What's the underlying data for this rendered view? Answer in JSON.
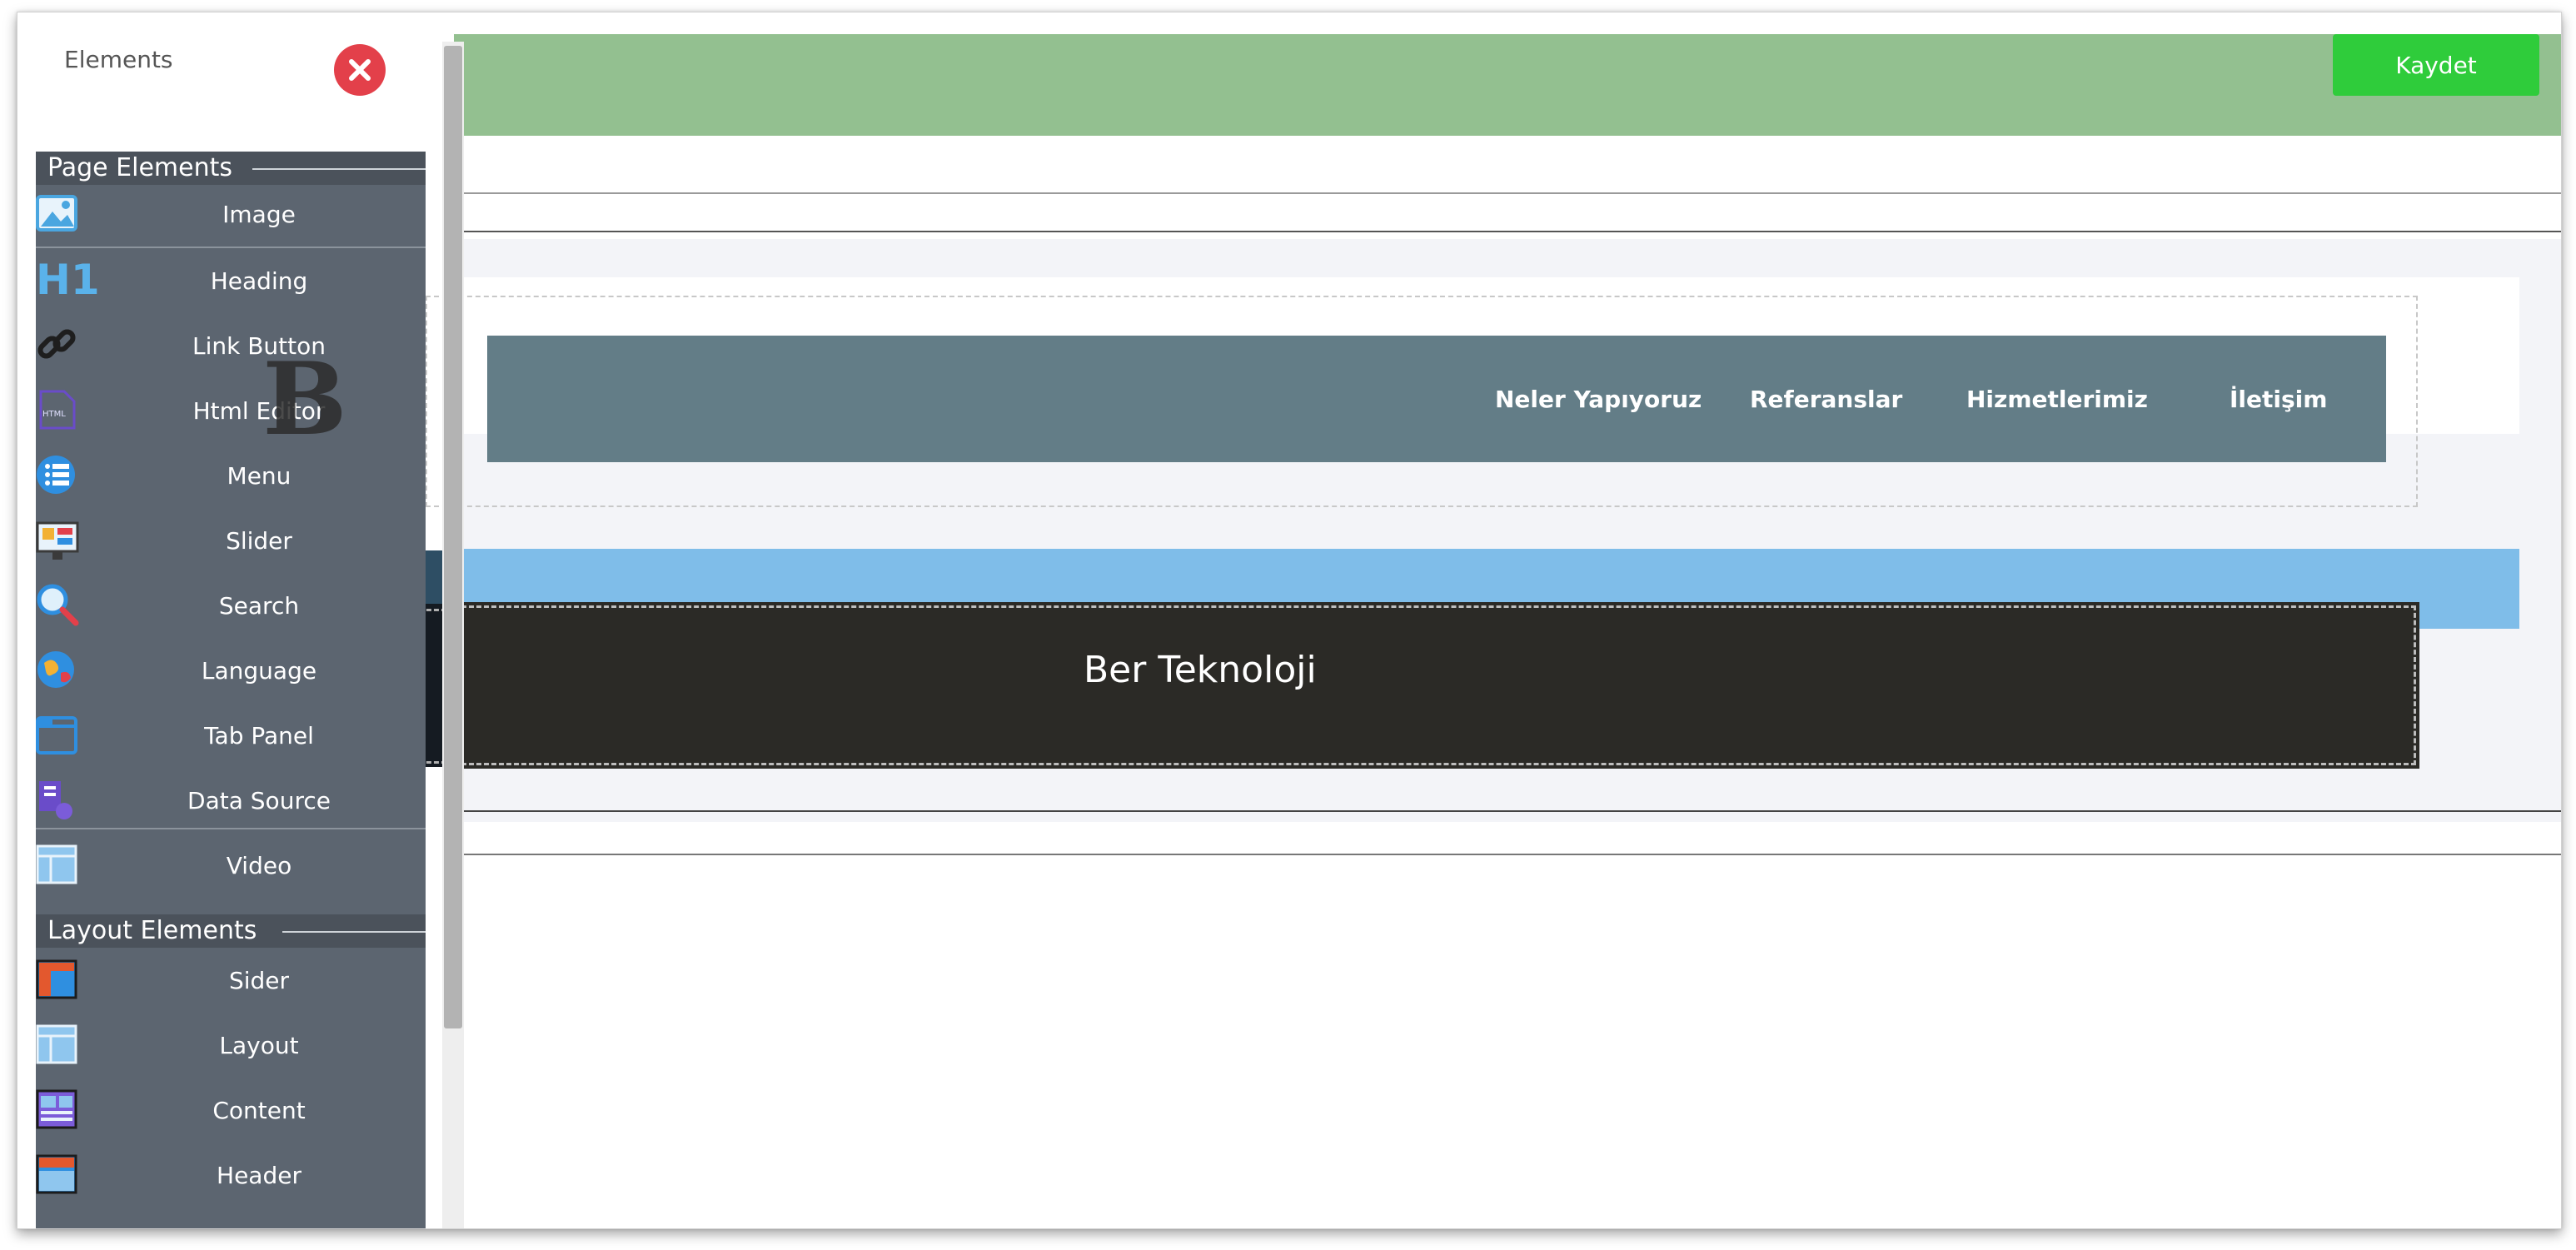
{
  "panel": {
    "title": "Elements",
    "close_icon": "close-icon",
    "page_elements_label": "Page Elements",
    "layout_elements_label": "Layout Elements",
    "page_items": [
      {
        "label": "Image",
        "icon": "image-icon"
      },
      {
        "label": "Heading",
        "icon": "heading-icon",
        "glyph": "H1"
      },
      {
        "label": "Link Button",
        "icon": "link-icon"
      },
      {
        "label": "Html Editor",
        "icon": "html-icon",
        "glyph": "HTML"
      },
      {
        "label": "Menu",
        "icon": "menu-icon"
      },
      {
        "label": "Slider",
        "icon": "slider-icon"
      },
      {
        "label": "Search",
        "icon": "search-icon"
      },
      {
        "label": "Language",
        "icon": "language-icon"
      },
      {
        "label": "Tab Panel",
        "icon": "tab-panel-icon"
      },
      {
        "label": "Data Source",
        "icon": "data-source-icon"
      },
      {
        "label": "Video",
        "icon": "video-icon"
      }
    ],
    "layout_items": [
      {
        "label": "Sider",
        "icon": "sider-icon"
      },
      {
        "label": "Layout",
        "icon": "layout-icon"
      },
      {
        "label": "Content",
        "icon": "content-icon"
      },
      {
        "label": "Header",
        "icon": "header-icon"
      }
    ]
  },
  "toolbar": {
    "save_label": "Kaydet"
  },
  "canvas": {
    "nav_items": [
      "Neler Yapıyoruz",
      "Referanslar",
      "Hizmetlerimiz",
      "İletişim"
    ],
    "footer_text": "Ber Teknoloji",
    "drag_ghost_glyph": "B"
  },
  "colors": {
    "top_bar": "#93c090",
    "save_button": "#2fcc3b",
    "panel_bg": "#5c6570",
    "nav_bar": "#637d87",
    "blue_band": "#7fbde9",
    "footer": "#2b2a26",
    "close_button": "#e3404a"
  }
}
